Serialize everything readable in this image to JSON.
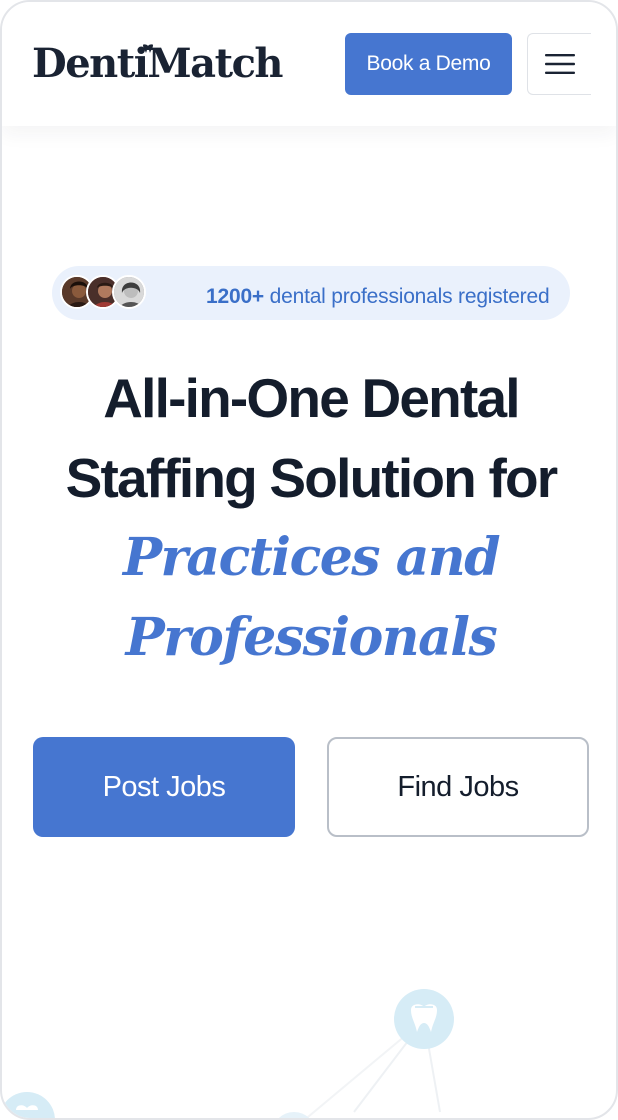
{
  "header": {
    "logo_text": "DentiMatch",
    "book_demo_label": "Book a Demo",
    "menu_icon": "hamburger-menu-icon"
  },
  "social_proof": {
    "count": "1200+",
    "text": "dental professionals registered",
    "avatars": [
      "avatar-1",
      "avatar-2",
      "avatar-3"
    ]
  },
  "hero": {
    "line1": "All-in-One Dental",
    "line2": "Staffing Solution for",
    "accent_line1": "Practices and",
    "accent_line2": "Professionals"
  },
  "cta": {
    "post_jobs_label": "Post Jobs",
    "find_jobs_label": "Find Jobs"
  },
  "colors": {
    "brand_blue": "#4676d0",
    "heading_dark": "#141d2c",
    "pill_bg": "#eaf1fc",
    "deco_light_blue": "#d6ecf6"
  }
}
